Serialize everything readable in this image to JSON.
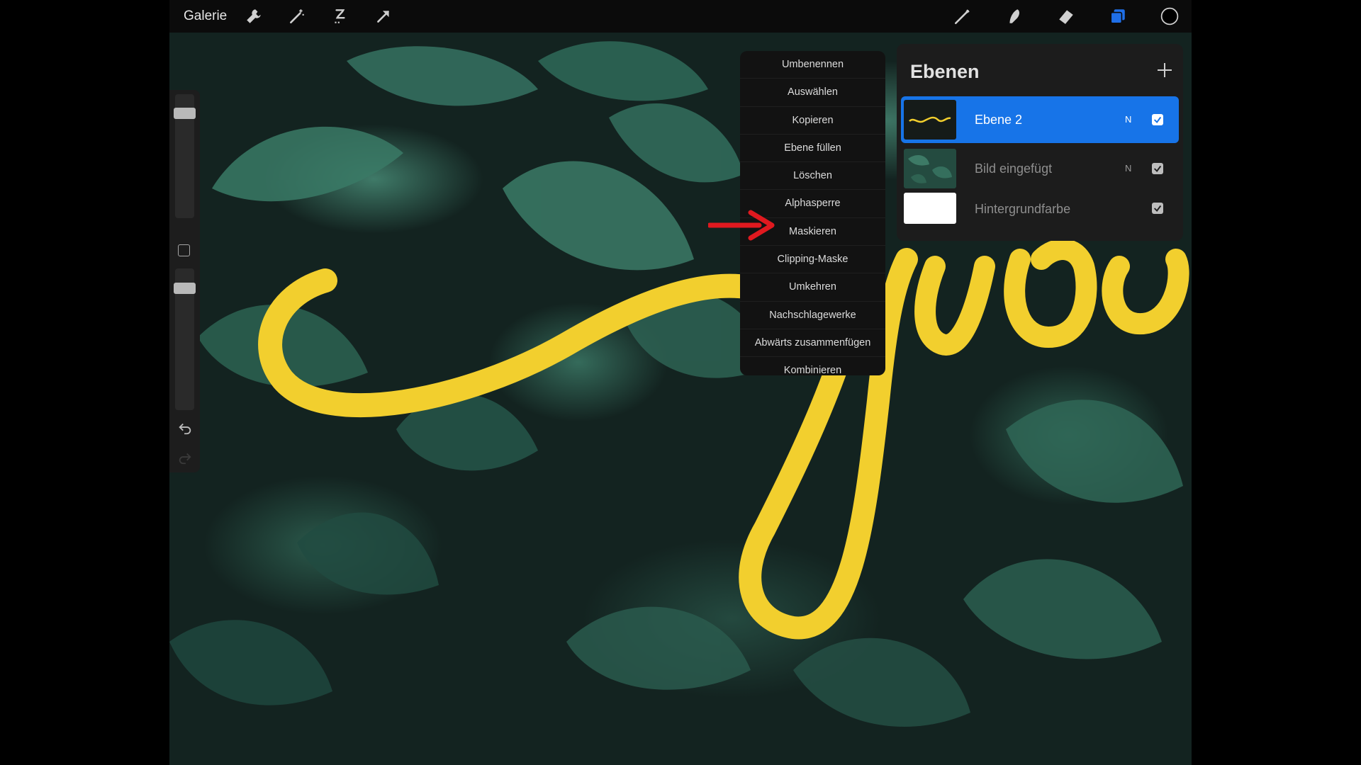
{
  "topbar": {
    "gallery_label": "Galerie",
    "left_tools": [
      "wrench-icon",
      "magic-wand-icon",
      "selection-icon",
      "transform-arrow-icon"
    ],
    "right_tools": [
      "brush-icon",
      "smudge-icon",
      "eraser-icon",
      "layers-icon",
      "color-icon"
    ],
    "active_tool_color": "#1f6fe8",
    "current_color": "#000000"
  },
  "sidebar": {
    "brush_size_level": 0.85,
    "opacity_level": 0.9
  },
  "layer_menu": {
    "items": [
      "Umbenennen",
      "Auswählen",
      "Kopieren",
      "Ebene füllen",
      "Löschen",
      "Alphasperre",
      "Maskieren",
      "Clipping-Maske",
      "Umkehren",
      "Nachschlagewerke",
      "Abwärts zusammenfügen",
      "Kombinieren"
    ],
    "highlighted_item": "Maskieren",
    "arrow_color": "#e0191f"
  },
  "layers_panel": {
    "title": "Ebenen",
    "layers": [
      {
        "name": "Ebene 2",
        "blend": "N",
        "visible": true,
        "active": true
      },
      {
        "name": "Bild eingefügt",
        "blend": "N",
        "visible": true,
        "active": false
      },
      {
        "name": "Hintergrundfarbe",
        "blend": "",
        "visible": true,
        "active": false
      }
    ],
    "active_color": "#1774e8"
  },
  "artwork": {
    "lettering_color": "#f2cf2e",
    "background": "dark green leaves"
  }
}
